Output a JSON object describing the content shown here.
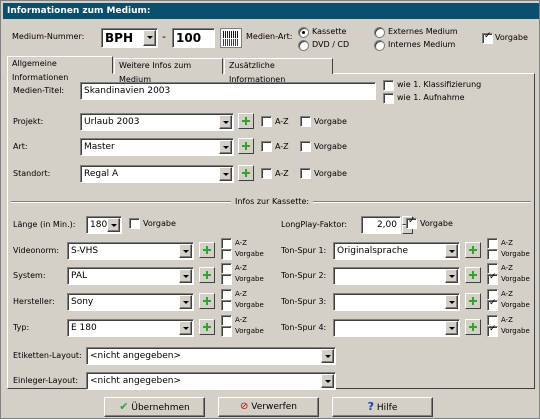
{
  "window": {
    "title": "Informationen zum Medium:"
  },
  "header": {
    "medium_nummer_label": "Medium-Nummer:",
    "prefix_value": "BPH",
    "dash": "-",
    "number_value": "100",
    "medien_art_label": "Medien-Art:",
    "radio_kassette": "Kassette",
    "radio_dvd": "DVD / CD",
    "radio_extern": "Externes Medium",
    "radio_intern": "Internes Medium",
    "vorgabe": "Vorgabe"
  },
  "tabs": [
    "Allgemeine Informationen",
    "Weitere Infos zum Medium",
    "Zusätzliche Informationen"
  ],
  "general": {
    "titel_label": "Medien-Titel:",
    "titel_value": "Skandinavien 2003",
    "wie_klass": "wie 1. Klassifizierung",
    "wie_aufnahme": "wie 1. Aufnahme",
    "projekt_label": "Projekt:",
    "projekt_value": "Urlaub 2003",
    "art_label": "Art:",
    "art_value": "Master",
    "standort_label": "Standort:",
    "standort_value": "Regal A",
    "az": "A-Z",
    "vorgabe": "Vorgabe"
  },
  "kassette": {
    "group_title": "Infos zur Kassette:",
    "laenge_label": "Länge (in Min.):",
    "laenge_value": "180",
    "longplay_label": "LongPlay-Faktor:",
    "longplay_value": "2,00",
    "videonorm_label": "Videonorm:",
    "videonorm_value": "S-VHS",
    "system_label": "System:",
    "system_value": "PAL",
    "hersteller_label": "Hersteller:",
    "hersteller_value": "Sony",
    "typ_label": "Typ:",
    "typ_value": "E 180",
    "ton1_label": "Ton-Spur 1:",
    "ton1_value": "Originalsprache",
    "ton2_label": "Ton-Spur 2:",
    "ton3_label": "Ton-Spur 3:",
    "ton4_label": "Ton-Spur 4:",
    "etiketten_label": "Etiketten-Layout:",
    "etiketten_value": "<nicht angegeben>",
    "einleger_label": "Einleger-Layout:",
    "einleger_value": "<nicht angegeben>",
    "az": "A-Z",
    "vorgabe": "Vorgabe"
  },
  "buttons": {
    "ok": "Übernehmen",
    "cancel": "Verwerfen",
    "help": "Hilfe"
  },
  "colors": {
    "titlebar": "#0a4f6e",
    "plus": "#2ea52e"
  }
}
